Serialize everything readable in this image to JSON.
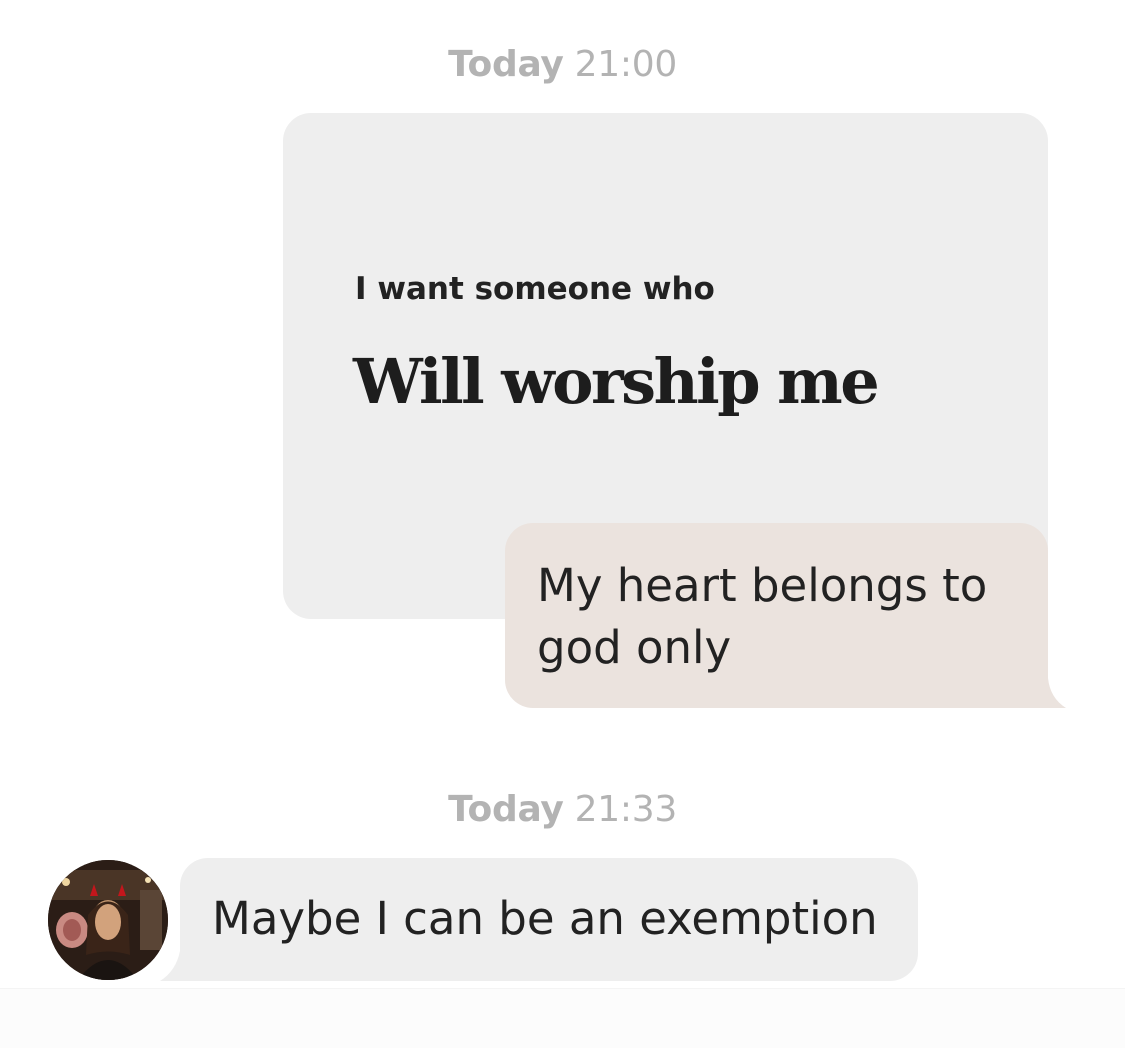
{
  "messages": [
    {
      "timestamp": {
        "day": "Today",
        "time": "21:00"
      },
      "prompt": {
        "question": "I want someone who",
        "answer": "Will worship me"
      },
      "reply": "My heart belongs to god only"
    },
    {
      "timestamp": {
        "day": "Today",
        "time": "21:33"
      },
      "incoming": "Maybe I can be an exemption"
    }
  ],
  "colors": {
    "prompt_bg": "#eeeeee",
    "outgoing_bg": "#ebe3de",
    "incoming_bg": "#eeeeee",
    "timestamp_text": "#b3b3b3",
    "message_text": "#222222"
  },
  "icons": {
    "avatar": "profile-photo"
  }
}
